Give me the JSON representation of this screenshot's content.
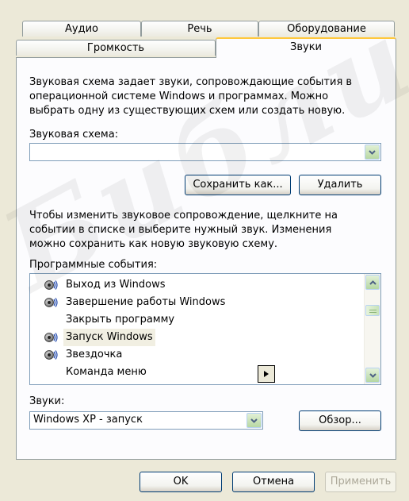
{
  "tabs": {
    "row1": [
      "Аудио",
      "Речь",
      "Оборудование"
    ],
    "row2": [
      "Громкость",
      "Звуки"
    ],
    "active": "Звуки"
  },
  "description": {
    "line1": "Звуковая схема задает звуки, сопровождающие события в",
    "line2": "операционной системе Windows и программах. Можно",
    "line3": "выбрать одну из существующих схем или создать новую."
  },
  "scheme": {
    "label": "Звуковая схема:",
    "value": ""
  },
  "buttons": {
    "save_as": "Сохранить как...",
    "delete": "Удалить",
    "browse": "Обзор...",
    "ok": "OK",
    "cancel": "Отмена",
    "apply": "Применить"
  },
  "instructions": {
    "line1": "Чтобы изменить звуковое сопровождение, щелкните на",
    "line2": "событии в списке и выберите нужный звук. Изменения",
    "line3": "можно сохранить как новую звуковую схему."
  },
  "events": {
    "label": "Программные события:",
    "items": [
      {
        "label": "Выход из Windows",
        "icon": "speaker-icon"
      },
      {
        "label": "Завершение работы Windows",
        "icon": "speaker-icon"
      },
      {
        "label": "Закрыть программу",
        "icon": ""
      },
      {
        "label": "Запуск Windows",
        "icon": "speaker-icon"
      },
      {
        "label": "Звездочка",
        "icon": "speaker-icon"
      },
      {
        "label": "Команда меню",
        "icon": ""
      }
    ],
    "selected_index": 3
  },
  "sounds": {
    "label": "Звуки:",
    "value": "Windows XP - запуск"
  },
  "watermark": "Библио",
  "colors": {
    "dialog_bg": "#ECE9D8",
    "tab_accent": "#FFC83C",
    "border_blue": "#7F9DB9",
    "button_border": "#003C74"
  }
}
